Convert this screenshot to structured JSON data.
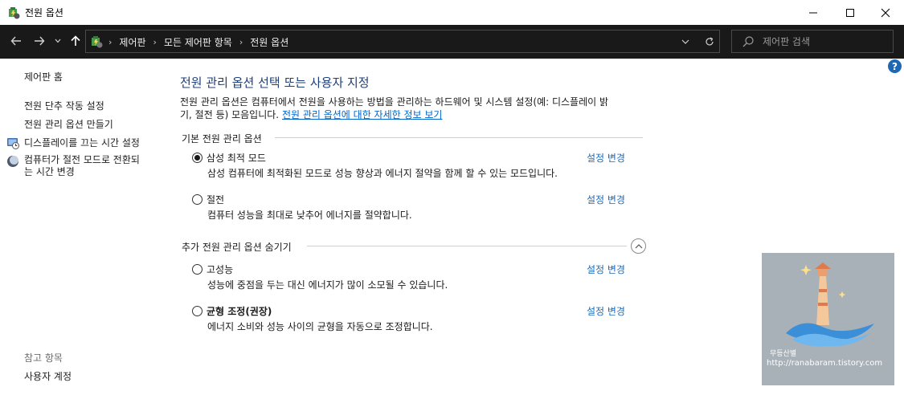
{
  "window": {
    "title": "전원 옵션"
  },
  "nav": {
    "breadcrumbs": [
      "제어판",
      "모든 제어판 항목",
      "전원 옵션"
    ],
    "search_placeholder": "제어판 검색"
  },
  "sidebar": {
    "home": "제어판 홈",
    "items": [
      {
        "label": "전원 단추 작동 설정",
        "icon": "none"
      },
      {
        "label": "전원 관리 옵션 만들기",
        "icon": "none"
      },
      {
        "label": "디스플레이를 끄는 시간 설정",
        "icon": "display-clock-icon"
      },
      {
        "label_line1": "컴퓨터가 절전 모드로 전환되",
        "label_line2": "는 시간 변경",
        "icon": "moon-icon"
      }
    ],
    "see_also_heading": "참고 항목",
    "see_also_items": [
      "사용자 계정"
    ]
  },
  "main": {
    "title": "전원 관리 옵션 선택 또는 사용자 지정",
    "description_line1": "전원 관리 옵션은 컴퓨터에서 전원을 사용하는 방법을 관리하는 하드웨어 및 시스템 설정(예: 디스플레이 밝",
    "description_line2_prefix": "기, 절전 등) 모음입니다. ",
    "description_link": "전원 관리 옵션에 대한 자세한 정보 보기",
    "basic_group": "기본 전원 관리 옵션",
    "additional_group": "추가 전원 관리 옵션 숨기기",
    "edit_label": "설정 변경",
    "plans": [
      {
        "name": "삼성 최적 모드",
        "description": "삼성 컴퓨터에 최적화된 모드로 성능 향상과 에너지 절약을 함께 할 수 있는 모드입니다.",
        "selected": true
      },
      {
        "name": "절전",
        "description": "컴퓨터 성능을 최대로 낮추어 에너지를 절약합니다.",
        "selected": false
      },
      {
        "name": "고성능",
        "description": "성능에 중점을 두는 대신 에너지가 많이 소모될 수 있습니다.",
        "selected": false
      },
      {
        "name": "균형 조정(권장)",
        "description": "에너지 소비와 성능 사이의 균형을 자동으로 조정합니다.",
        "selected": false
      }
    ]
  },
  "watermark": {
    "line1": "무등산별",
    "line2": "http://ranabaram.tistory.com"
  },
  "colors": {
    "accent_link": "#1e6bb8",
    "title_blue": "#1e3f77",
    "navbar_bg": "#191919"
  }
}
